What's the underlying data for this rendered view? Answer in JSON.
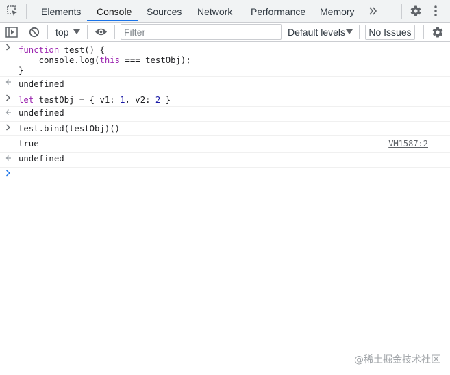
{
  "tabs": [
    {
      "label": "Elements",
      "active": false
    },
    {
      "label": "Console",
      "active": true
    },
    {
      "label": "Sources",
      "active": false
    },
    {
      "label": "Network",
      "active": false
    },
    {
      "label": "Performance",
      "active": false
    },
    {
      "label": "Memory",
      "active": false
    }
  ],
  "tabbar_icons": [
    "inspect-element-icon",
    "more-tabs-icon",
    "settings-icon",
    "kebab-menu-icon"
  ],
  "toolbar": {
    "context": "top",
    "filter_placeholder": "Filter",
    "levels": "Default levels",
    "issues": "No Issues",
    "icons": [
      "sidebar-toggle-icon",
      "clear-console-icon",
      "context-dropdown-icon",
      "live-expression-eye-icon",
      "levels-dropdown-icon",
      "console-settings-icon"
    ]
  },
  "console": {
    "entries": [
      {
        "type": "input",
        "lines": [
          "function test() {",
          "    console.log(this === testObj);",
          "}"
        ]
      },
      {
        "type": "result",
        "text": "undefined"
      },
      {
        "type": "input",
        "text": "let testObj = { v1: 1, v2: 2 }"
      },
      {
        "type": "result",
        "text": "undefined"
      },
      {
        "type": "input",
        "text": "test.bind(testObj)()"
      },
      {
        "type": "log",
        "text": "true",
        "source": "VM1587:2"
      },
      {
        "type": "result",
        "text": "undefined"
      }
    ]
  },
  "colors": {
    "accent": "#1a73e8",
    "keyword": "#9c27b0",
    "number": "#1a1aa6",
    "prompt_active": "#1a73e8"
  },
  "watermark": "@稀土掘金技术社区"
}
